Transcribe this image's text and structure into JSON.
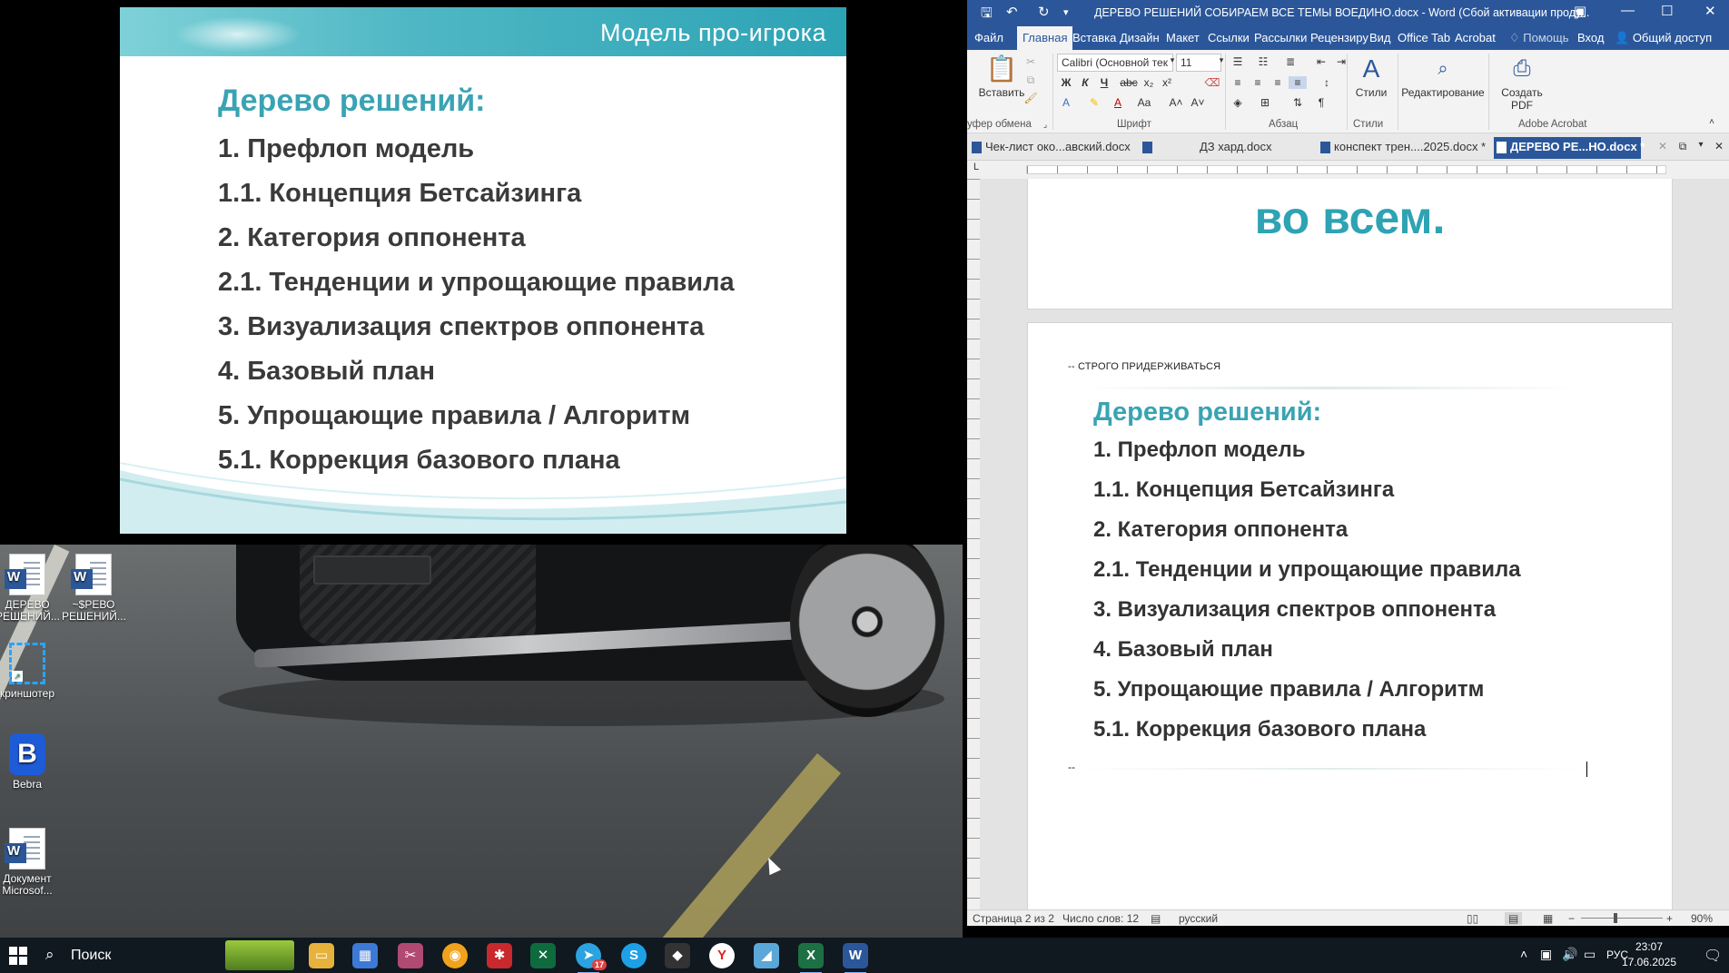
{
  "slide": {
    "header": "Модель про-игрока",
    "title": "Дерево решений:",
    "items": [
      "1. Префлоп модель",
      "1.1. Концепция Бетсайзинга",
      "2. Категория оппонента",
      "2.1. Тенденции и упрощающие правила",
      "3. Визуализация спектров оппонента",
      "4. Базовый план",
      "5. Упрощающие правила / Алгоритм",
      "5.1. Коррекция базового плана"
    ],
    "accent": "#3aa3b3"
  },
  "desktop": {
    "icons": [
      {
        "label": "ДЕРЕВО РЕШЕНИЙ...",
        "icon": "word-doc-icon"
      },
      {
        "label": "~$РЕВО РЕШЕНИЙ...",
        "icon": "word-doc-icon"
      },
      {
        "label": "криншотер",
        "icon": "screenshot-tool-icon"
      },
      {
        "label": "Bebra",
        "icon": "bebra-app-icon",
        "glyph": "B"
      },
      {
        "label": "Документ Microsof...",
        "icon": "word-doc-icon"
      }
    ]
  },
  "word": {
    "title": "ДЕРЕВО РЕШЕНИЙ СОБИРАЕМ ВСЕ ТЕМЫ ВОЕДИНО.docx - Word (Сбой активации проду...",
    "menu": [
      "Файл",
      "Главная",
      "Вставка",
      "Дизайн",
      "Макет",
      "Ссылки",
      "Рассылки",
      "Рецензиру",
      "Вид",
      "Office Tab",
      "Acrobat",
      "Помощь",
      "Вход",
      "Общий доступ"
    ],
    "ribbon": {
      "paste_label": "Вставить",
      "clipboard_label": "уфер обмена",
      "font_name": "Calibri (Основной тек",
      "font_size": "11",
      "font_group_label": "Шрифт",
      "paragraph_group_label": "Абзац",
      "styles_label": "Стили",
      "editing_label": "Редактирование",
      "create_pdf_label": "Создать PDF",
      "acrobat_group_label": "Adobe Acrobat",
      "bold": "Ж",
      "italic": "К",
      "underline": "Ч"
    },
    "doc_tabs": [
      "Чек-лист око...авский.docx",
      "ДЗ хард.docx",
      "конспект трен....2025.docx *",
      "ДЕРЕВО РЕ...НО.docx *"
    ],
    "page1_text": "во всем.",
    "note": "-- СТРОГО ПРИДЕРЖИВАТЬСЯ",
    "doc_title": "Дерево решений:",
    "doc_items": [
      "1. Префлоп модель",
      "1.1. Концепция Бетсайзинга",
      "2. Категория оппонента",
      "2.1. Тенденции и упрощающие правила",
      "3. Визуализация спектров оппонента",
      "4. Базовый план",
      "5. Упрощающие правила / Алгоритм",
      "5.1. Коррекция базового плана"
    ],
    "end_dash": "--",
    "status": {
      "page": "Страница 2 из 2",
      "words": "Число слов: 12",
      "language": "русский",
      "zoom": "90%"
    }
  },
  "taskbar": {
    "search_label": "Поиск",
    "telegram_badge": "17",
    "lang": "РУС",
    "time": "23:07",
    "date": "17.06.2025"
  }
}
